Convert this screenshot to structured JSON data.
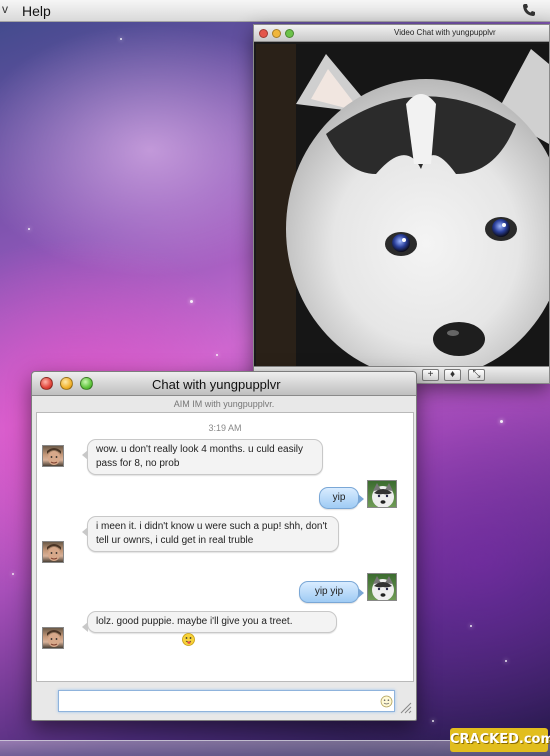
{
  "menubar": {
    "help_label": "Help"
  },
  "video_window": {
    "title": "Video Chat with yungpupplvr",
    "controls": [
      "+",
      "⚲",
      "⤡"
    ]
  },
  "chat_window": {
    "title": "Chat with yungpupplvr",
    "subtitle": "AIM IM with yungpupplvr.",
    "timestamp": "3:19 AM",
    "messages": [
      {
        "sender": "them",
        "text": "wow. u don't really look 4 months. u culd easily pass for 8, no prob"
      },
      {
        "sender": "me",
        "text": "yip"
      },
      {
        "sender": "them",
        "text": "i meen it. i didn't know u were such a pup! shh, don't tell ur ownrs, i culd get in real truble"
      },
      {
        "sender": "me",
        "text": "yip yip"
      },
      {
        "sender": "them",
        "text": "lolz. good puppie. maybe i'll give you a treet."
      }
    ],
    "input": {
      "value": "",
      "placeholder": ""
    }
  },
  "watermark": "CRACKED.com",
  "colors": {
    "outgoing_bubble": "#9fcbf4",
    "incoming_bubble": "#f3f3f3",
    "watermark_bg": "#e2be1e"
  }
}
